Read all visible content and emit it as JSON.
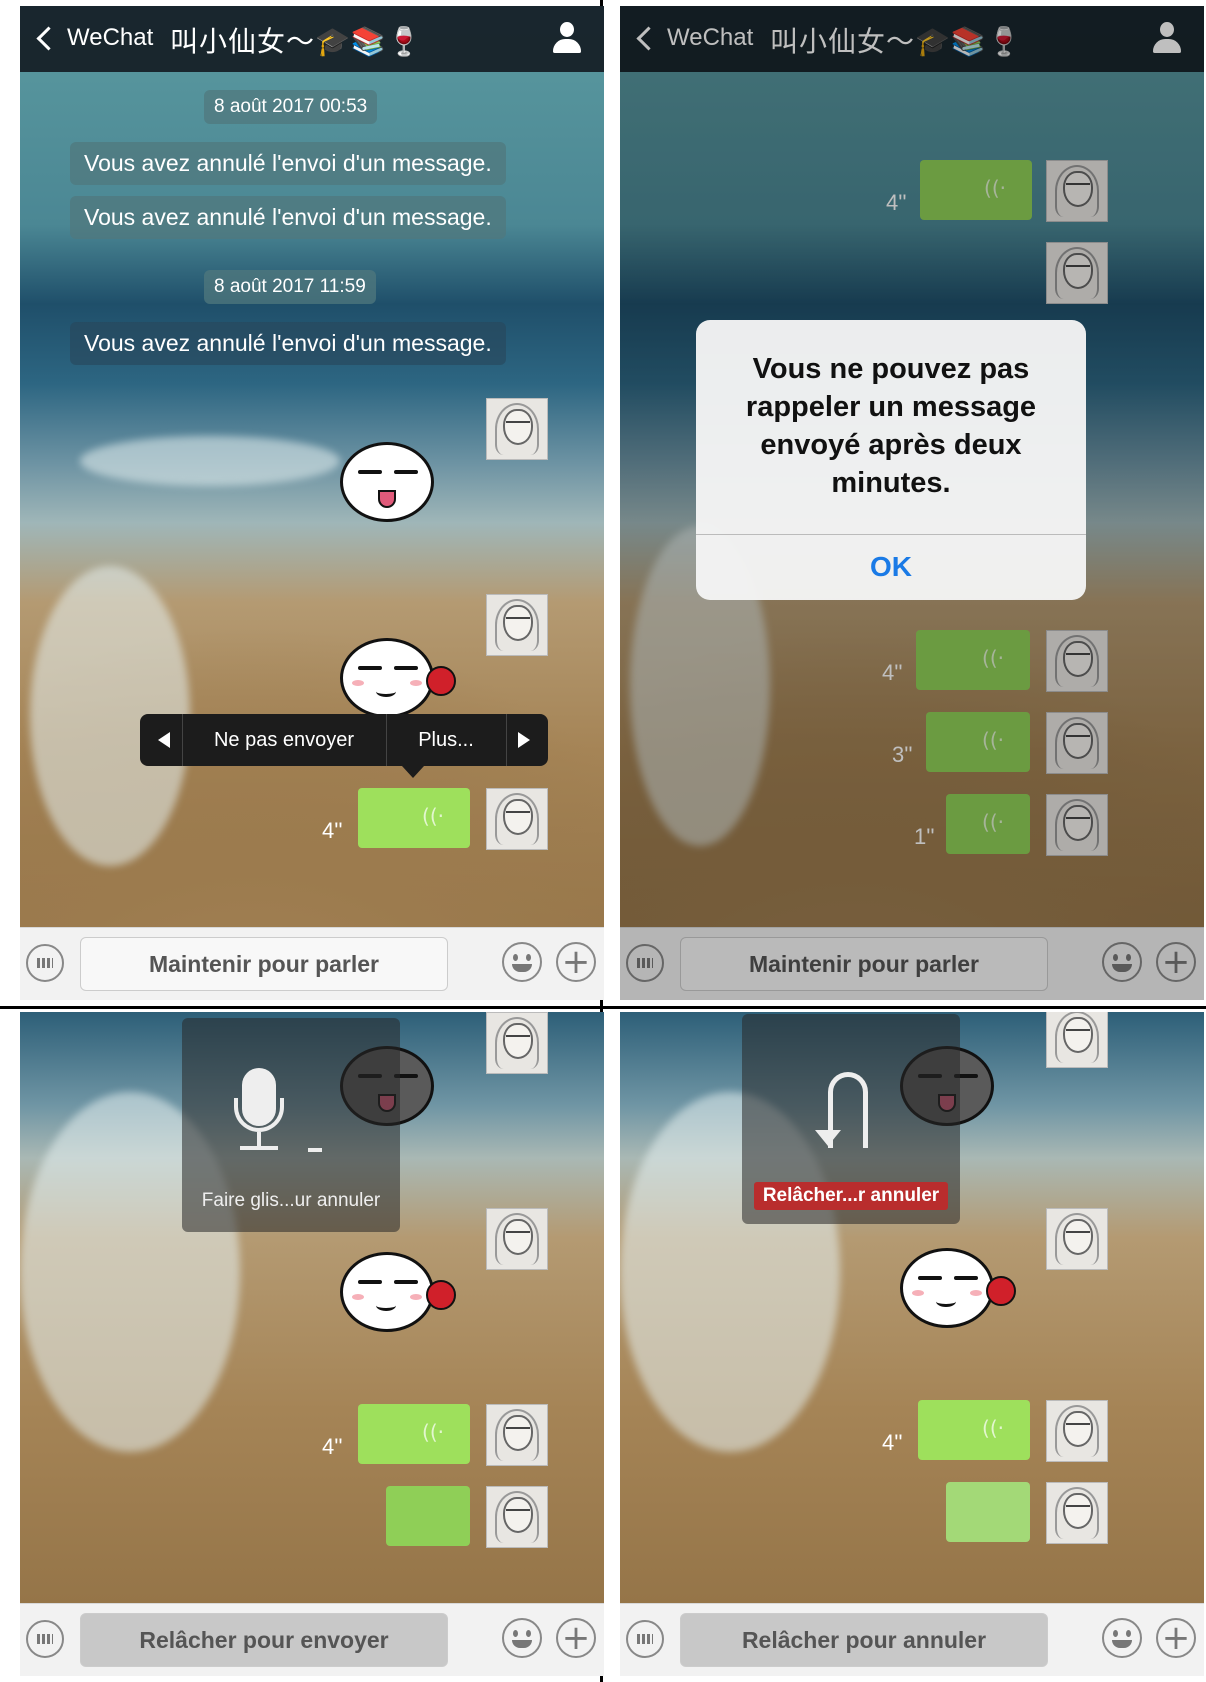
{
  "header": {
    "back_label": "WeChat",
    "chat_title": "叫小仙女～🎓📚🍷",
    "ear_icon": "ear-icon"
  },
  "panel1": {
    "timestamps": [
      "8 août 2017 00:53",
      "8 août 2017 11:59"
    ],
    "system_messages": [
      "Vous avez annulé l'envoi d'un message.",
      "Vous avez annulé l'envoi d'un message.",
      "Vous avez annulé l'envoi d'un message."
    ],
    "context_menu": {
      "items": [
        "Ne pas envoyer",
        "Plus..."
      ]
    },
    "voice_duration": "4''",
    "input_button": "Maintenir pour parler"
  },
  "panel2": {
    "voice_durations": [
      "4''",
      "4''",
      "3''",
      "1''"
    ],
    "alert": {
      "message": "Vous ne pouvez pas rappeler un message envoyé après deux minutes.",
      "ok_label": "OK"
    },
    "input_button": "Maintenir pour parler"
  },
  "panel3": {
    "recording_hint": "Faire glis...ur annuler",
    "voice_duration": "4''",
    "input_button": "Relâcher pour envoyer"
  },
  "panel4": {
    "recording_hint": "Relâcher...r annuler",
    "voice_duration": "4''",
    "input_button": "Relâcher pour annuler"
  },
  "colors": {
    "voice_bubble": "#8fcf57",
    "alert_ok": "#1a7ae6",
    "cancel_red": "#b92d2d",
    "navbar": "#141c24"
  }
}
